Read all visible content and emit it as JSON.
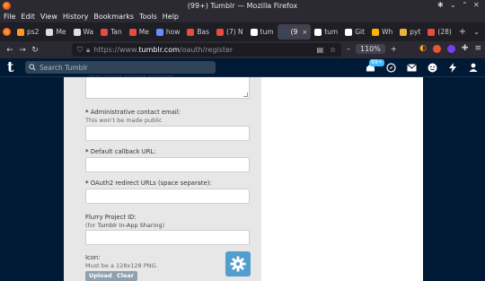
{
  "window": {
    "title": "(99+) Tumblr — Mozilla Firefox"
  },
  "menu": [
    "File",
    "Edit",
    "View",
    "History",
    "Bookmarks",
    "Tools",
    "Help"
  ],
  "tabs": [
    {
      "label": "ps2",
      "color": "#ff9a1f"
    },
    {
      "label": "Me",
      "color": "#dddddd"
    },
    {
      "label": "Wa",
      "color": "#e0e0e0"
    },
    {
      "label": "Tan",
      "color": "#e74c3c"
    },
    {
      "label": "Me",
      "color": "#e74c3c"
    },
    {
      "label": "how",
      "color": "#6b8cff"
    },
    {
      "label": "Bas",
      "color": "#e74c3c"
    },
    {
      "label": "(7) N",
      "color": "#e74c3c"
    },
    {
      "label": "tum",
      "color": "#ffffff"
    },
    {
      "label": "(9",
      "color": "#36465d",
      "active": true
    },
    {
      "label": "tum",
      "color": "#ffffff"
    },
    {
      "label": "Git",
      "color": "#ffffff"
    },
    {
      "label": "Wh",
      "color": "#ffb400"
    },
    {
      "label": "pyt",
      "color": "#e8b43a"
    },
    {
      "label": "(28)",
      "color": "#e74c3c"
    }
  ],
  "tab_close": "×",
  "tab_new": "+",
  "tab_more": "⌄",
  "url": {
    "protocol": "https://www.",
    "domain": "tumblr.com",
    "path": "/oauth/register"
  },
  "zoom": "110%",
  "zoom_minus": "–",
  "zoom_plus": "+",
  "tumblr": {
    "logo": "t",
    "search_placeholder": "Search Tumblr",
    "notif_badge": "99+"
  },
  "form": {
    "cut_text": "**** ****** ******* ********",
    "admin_email_label": "Administrative contact email:",
    "admin_email_sub": "This won't be made public",
    "callback_label": "Default callback URL:",
    "redirect_label": "OAuth2 redirect URLs (space separate):",
    "flurry_label": "Flurry Project ID:",
    "flurry_sub_prefix": "(for ",
    "flurry_sub_bold": "Tumblr In-App Sharing",
    "flurry_sub_suffix": ")",
    "icon_label": "Icon:",
    "icon_sub": "Must be a 128x128 PNG.",
    "upload_label": "Upload",
    "clear_label": "Clear",
    "required_mark": "*"
  }
}
